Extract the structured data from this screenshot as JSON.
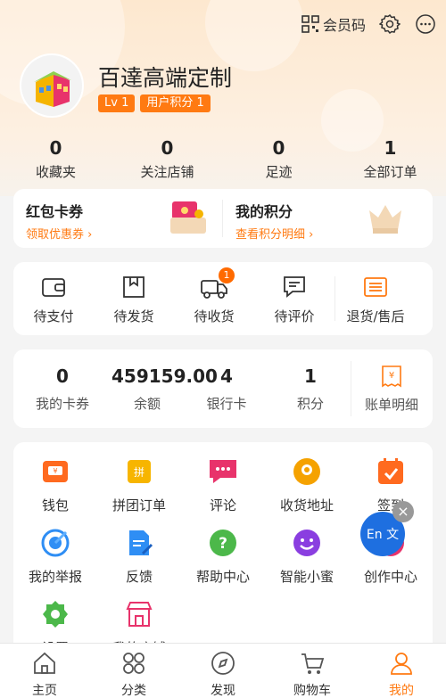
{
  "header": {
    "member_code_label": "会员码",
    "shop_name": "百達高端定制",
    "level_badge": "Lv 1",
    "points_badge": "用户积分 1"
  },
  "stats": [
    {
      "value": "0",
      "label": "收藏夹"
    },
    {
      "value": "0",
      "label": "关注店铺"
    },
    {
      "value": "0",
      "label": "足迹"
    },
    {
      "value": "1",
      "label": "全部订单"
    }
  ],
  "coupons": {
    "left_title": "红包卡券",
    "left_sub": "领取优惠券",
    "right_title": "我的积分",
    "right_sub": "查看积分明细"
  },
  "orders": [
    {
      "label": "待支付",
      "icon": "wallet-icon"
    },
    {
      "label": "待发货",
      "icon": "box-icon"
    },
    {
      "label": "待收货",
      "icon": "truck-icon",
      "badge": "1"
    },
    {
      "label": "待评价",
      "icon": "comment-icon"
    },
    {
      "label": "退货/售后",
      "icon": "refund-icon"
    }
  ],
  "wallet": [
    {
      "value": "0",
      "label": "我的卡券"
    },
    {
      "value": "459159.00",
      "label": "余额"
    },
    {
      "value": "4",
      "label": "银行卡"
    },
    {
      "value": "1",
      "label": "积分"
    }
  ],
  "wallet_bill_label": "账单明细",
  "services": [
    {
      "label": "钱包",
      "icon": "wallet-icon",
      "color": "#ff6a1f"
    },
    {
      "label": "拼团订单",
      "icon": "group-buy-icon",
      "color": "#f7b500"
    },
    {
      "label": "评论",
      "icon": "comment-icon",
      "color": "#e8336b"
    },
    {
      "label": "收货地址",
      "icon": "location-icon",
      "color": "#f5a200"
    },
    {
      "label": "签到",
      "icon": "calendar-icon",
      "color": "#ff6a1f"
    },
    {
      "label": "我的举报",
      "icon": "target-icon",
      "color": "#2f8ef4"
    },
    {
      "label": "反馈",
      "icon": "feedback-icon",
      "color": "#2f8ef4"
    },
    {
      "label": "帮助中心",
      "icon": "help-icon",
      "color": "#4cb84a"
    },
    {
      "label": "智能小蜜",
      "icon": "bot-icon",
      "color": "#8a3ee0"
    },
    {
      "label": "创作中心",
      "icon": "create-icon",
      "color": "#e8336b"
    },
    {
      "label": "设置",
      "icon": "settings-icon",
      "color": "#4cb84a"
    },
    {
      "label": "我的店铺",
      "icon": "shop-icon",
      "color": "#e8336b"
    }
  ],
  "translate": {
    "text": "En 文",
    "close": "×"
  },
  "nav": [
    {
      "label": "主页",
      "icon": "home-icon"
    },
    {
      "label": "分类",
      "icon": "category-icon"
    },
    {
      "label": "发现",
      "icon": "compass-icon"
    },
    {
      "label": "购物车",
      "icon": "cart-icon"
    },
    {
      "label": "我的",
      "icon": "user-icon",
      "active": true
    }
  ],
  "colors": {
    "accent": "#ff7a12",
    "header_bg": "#fde8cf"
  }
}
